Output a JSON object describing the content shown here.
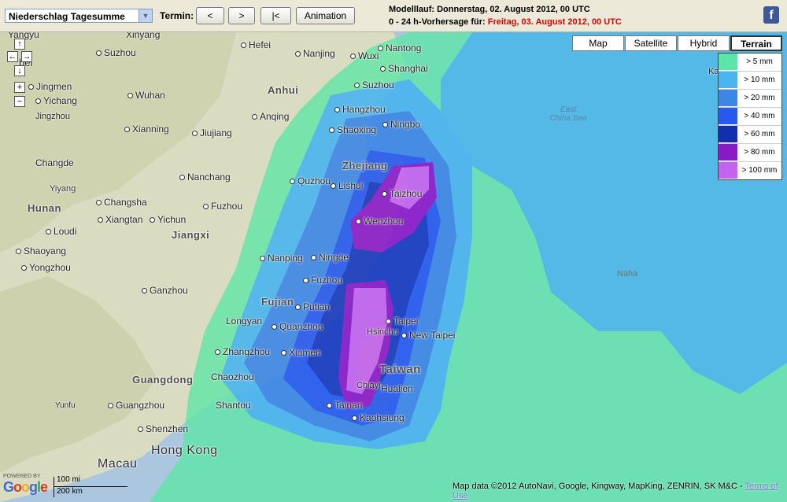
{
  "toolbar": {
    "product_select": "Niederschlag Tagesumme",
    "termin_label": "Termin:",
    "btn_prev": "<",
    "btn_next": ">",
    "btn_first": "|<",
    "btn_animation": "Animation",
    "model_run": "Modelllauf: Donnerstag, 02. August 2012, 00 UTC",
    "forecast_prefix": "0 - 24 h-Vorhersage für:",
    "forecast_date": "Freitag, 03. August 2012, 00 UTC",
    "facebook_glyph": "f"
  },
  "map_types": [
    "Map",
    "Satellite",
    "Hybrid",
    "Terrain"
  ],
  "active_map_type": "Terrain",
  "legend": [
    {
      "label": "> 5 mm",
      "color": "#5ae6a6"
    },
    {
      "label": "> 10 mm",
      "color": "#49b5ee"
    },
    {
      "label": "> 20 mm",
      "color": "#3c86e6"
    },
    {
      "label": "> 40 mm",
      "color": "#2659ee"
    },
    {
      "label": "> 60 mm",
      "color": "#122fb0"
    },
    {
      "label": "> 80 mm",
      "color": "#8a19c8"
    },
    {
      "label": "> 100 mm",
      "color": "#c463ee"
    }
  ],
  "pan_controls": {
    "up": "↑",
    "left": "←",
    "right": "→",
    "down": "↓",
    "zoom_in": "+",
    "zoom_out": "−"
  },
  "places": {
    "xinyang": "Xinyang",
    "hefei": "Hefei",
    "nanjing": "Nanjing",
    "wuxi": "Wuxi",
    "nantong": "Nantong",
    "suzhou_a": "Suzhou",
    "shanghai": "Shanghai",
    "suzhou_j": "Suzhou",
    "wuhan": "Wuhan",
    "anqing": "Anqing",
    "hangzhou": "Hangzhou",
    "ningbo": "Ningbo",
    "jingmen": "Jingmen",
    "yichang": "Yichang",
    "jingzhou": "Jingzhou",
    "xianning": "Xianning",
    "jiujiang": "Jiujiang",
    "shaoxing": "Shaoxing",
    "changde": "Changde",
    "nanchang": "Nanchang",
    "quzhou": "Quzhou",
    "lishui": "Lishui",
    "taizhou": "Taizhou",
    "wenzhou": "Wenzhou",
    "yiyang": "Yiyang",
    "changsha": "Changsha",
    "xiangtan": "Xiangtan",
    "yichun": "Yichun",
    "fuzhou_jx": "Fuzhou",
    "loudi": "Loudi",
    "shaoyang": "Shaoyang",
    "nanping": "Nanping",
    "ningde": "Ningde",
    "yongzhou": "Yongzhou",
    "fuzhou_fj": "Fuzhou",
    "ganzhou": "Ganzhou",
    "putian": "Putian",
    "longyan": "Longyan",
    "quanzhou": "Quanzhou",
    "taipei": "Taipei",
    "new_taipei": "New Taipei",
    "hsinchu": "Hsinchu",
    "zhangzhou": "Zhangzhou",
    "xiamen": "Xiamen",
    "chiayi": "Chiayi",
    "hualien": "Hualien",
    "chaozhou": "Chaozhou",
    "tainan": "Tainan",
    "kaohsiung": "Kaohsiung",
    "shantou": "Shantou",
    "yunfu": "Yunfu",
    "guangzhou": "Guangzhou",
    "shenzhen": "Shenzhen",
    "hong_kong": "Hong Kong",
    "macau": "Macau",
    "ka": "Ka",
    "naha": "Naha",
    "yangyu": "Yangyu",
    "bei": "bei"
  },
  "provinces": {
    "anhui": "Anhui",
    "zhejiang": "Zhejiang",
    "hunan": "Hunan",
    "jiangxi": "Jiangxi",
    "fujian": "Fujian",
    "guangdong": "Guangdong",
    "taiwan": "Taiwan"
  },
  "seas": {
    "east_china_sea": "East\nChina Sea"
  },
  "scale": {
    "miles": "100 mi",
    "km": "200 km"
  },
  "google": {
    "powered_by": "POWERED BY",
    "logo": "Google"
  },
  "attribution": "Map data ©2012 AutoNavi, Google, Kingway, MapKing, ZENRIN, SK M&C -",
  "attribution_link": "Terms of Use"
}
